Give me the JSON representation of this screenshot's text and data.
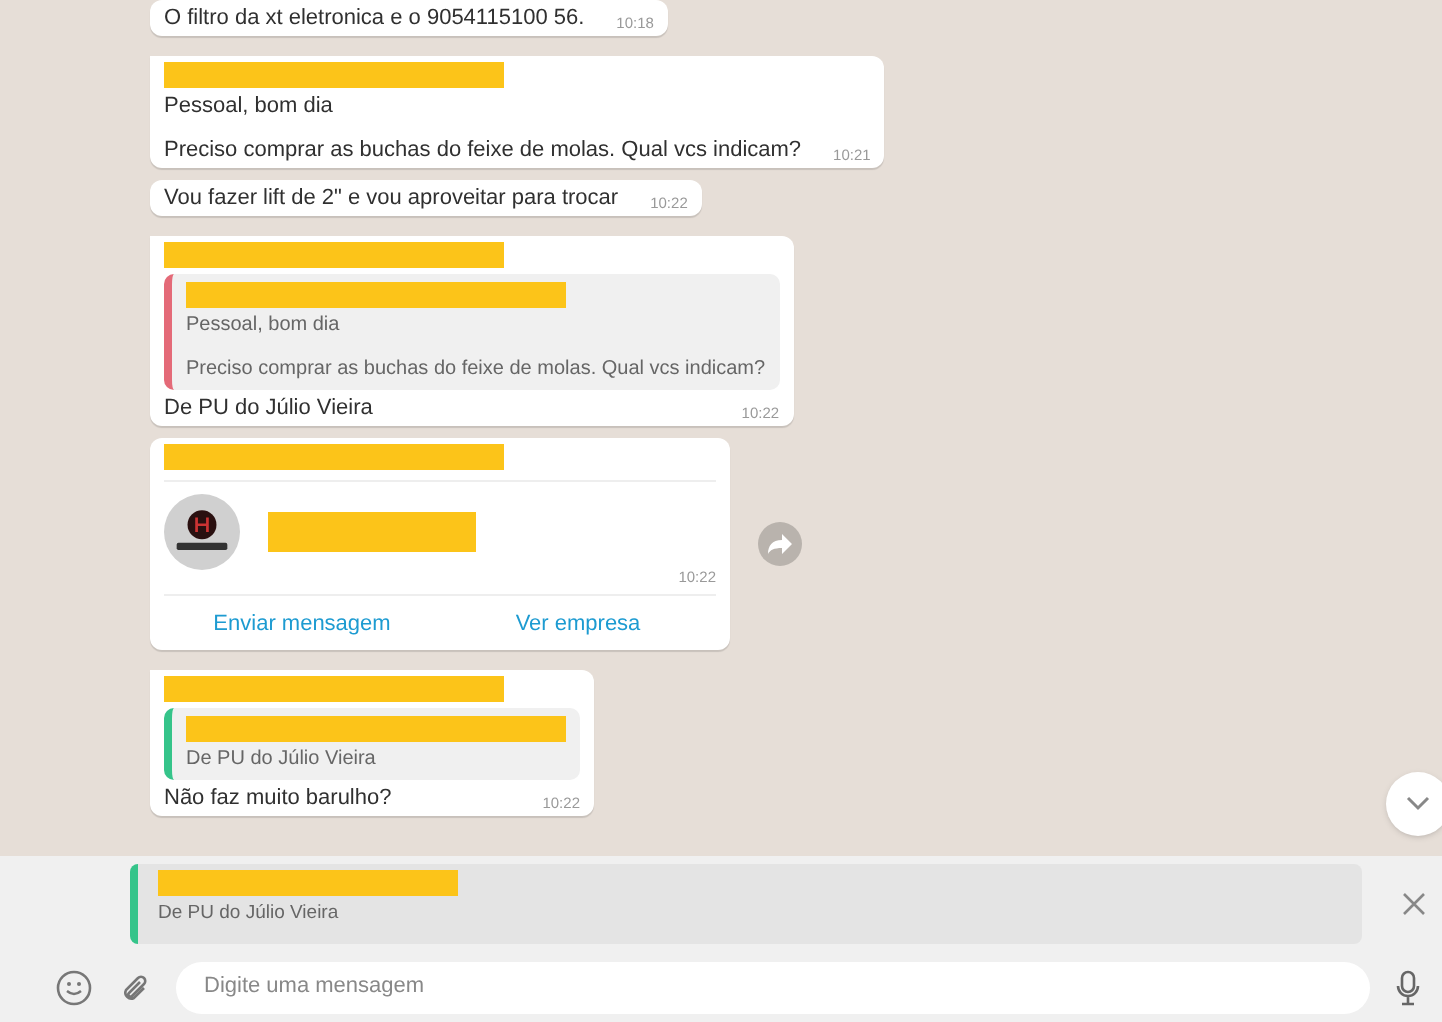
{
  "messages": [
    {
      "kind": "text",
      "redacted_sender": false,
      "tail": false,
      "paragraphs": [
        "O filtro da xt eletronica e o 9054115100 56."
      ],
      "time": "10:18"
    },
    {
      "kind": "text",
      "redacted_sender": true,
      "tail": true,
      "paragraphs": [
        "Pessoal, bom dia",
        "Preciso comprar as buchas do feixe de molas. Qual vcs indicam?"
      ],
      "time": "10:21"
    },
    {
      "kind": "text",
      "redacted_sender": false,
      "tail": false,
      "paragraphs": [
        "Vou fazer lift de 2\" e vou aproveitar para trocar"
      ],
      "time": "10:22"
    },
    {
      "kind": "reply",
      "redacted_sender": true,
      "tail": true,
      "quote": {
        "color": "#e46a78",
        "paragraphs": [
          "Pessoal, bom dia",
          "Preciso comprar as buchas do feixe de molas. Qual vcs indicam?"
        ]
      },
      "paragraphs": [
        "De PU do Júlio Vieira"
      ],
      "time": "10:22"
    },
    {
      "kind": "business",
      "redacted_sender": true,
      "tail": false,
      "time": "10:22",
      "actions": [
        "Enviar mensagem",
        "Ver empresa"
      ]
    },
    {
      "kind": "reply",
      "redacted_sender": true,
      "tail": true,
      "quote": {
        "color": "#35c48a",
        "paragraphs": [
          "De PU do Júlio Vieira"
        ]
      },
      "paragraphs": [
        "Não faz muito barulho?"
      ],
      "time": "10:22"
    }
  ],
  "reply_preview": {
    "color": "#35c48a",
    "text": "De PU do Júlio Vieira"
  },
  "composer": {
    "placeholder": "Digite uma mensagem"
  }
}
